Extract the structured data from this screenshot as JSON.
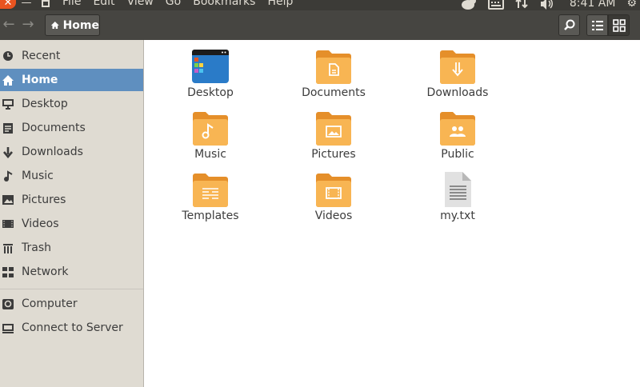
{
  "menubar": {
    "close_glyph": "✕",
    "min_glyph": "—",
    "items": [
      "File",
      "Edit",
      "View",
      "Go",
      "Bookmarks",
      "Help"
    ],
    "time": "8:41 AM",
    "indicator_icons": [
      "messaging-icon",
      "keyboard-icon",
      "network-updown-icon",
      "volume-icon"
    ],
    "settings_glyph": "⚙"
  },
  "toolbar": {
    "back_glyph": "←",
    "forward_glyph": "→",
    "path_label": "Home",
    "active_view": "grid"
  },
  "sidebar": {
    "items": [
      {
        "label": "Recent",
        "icon": "clock-icon",
        "selected": false
      },
      {
        "label": "Home",
        "icon": "home-icon",
        "selected": true
      },
      {
        "label": "Desktop",
        "icon": "desktop-icon",
        "selected": false
      },
      {
        "label": "Documents",
        "icon": "documents-icon",
        "selected": false
      },
      {
        "label": "Downloads",
        "icon": "downloads-icon",
        "selected": false
      },
      {
        "label": "Music",
        "icon": "music-icon",
        "selected": false
      },
      {
        "label": "Pictures",
        "icon": "pictures-icon",
        "selected": false
      },
      {
        "label": "Videos",
        "icon": "videos-icon",
        "selected": false
      },
      {
        "label": "Trash",
        "icon": "trash-icon",
        "selected": false
      },
      {
        "label": "Network",
        "icon": "network-icon",
        "selected": false
      }
    ],
    "devices": [
      {
        "label": "Computer",
        "icon": "computer-icon"
      },
      {
        "label": "Connect to Server",
        "icon": "connect-server-icon"
      }
    ]
  },
  "files": [
    {
      "name": "Desktop",
      "icon": "desktop-folder-icon"
    },
    {
      "name": "Documents",
      "icon": "documents-folder-icon"
    },
    {
      "name": "Downloads",
      "icon": "downloads-folder-icon"
    },
    {
      "name": "Music",
      "icon": "music-folder-icon"
    },
    {
      "name": "Pictures",
      "icon": "pictures-folder-icon"
    },
    {
      "name": "Public",
      "icon": "public-folder-icon"
    },
    {
      "name": "Templates",
      "icon": "templates-folder-icon"
    },
    {
      "name": "Videos",
      "icon": "videos-folder-icon"
    },
    {
      "name": "my.txt",
      "icon": "text-file-icon"
    }
  ],
  "colors": {
    "accent_orange": "#e95420",
    "folder": "#f6a94d",
    "selection": "#5f8fbf",
    "sidebar_bg": "#dfdbd2",
    "toolbar_bg": "#464541"
  }
}
